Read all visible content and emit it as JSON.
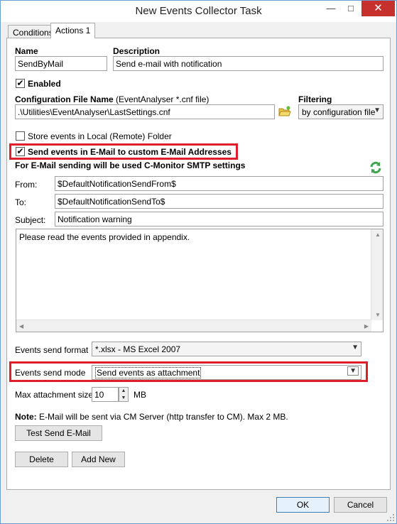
{
  "window": {
    "title": "New Events Collector Task",
    "minimize": "—",
    "maximize": "□",
    "close": "✕"
  },
  "tabs": [
    {
      "label": "Conditions"
    },
    {
      "label": "Actions 1"
    }
  ],
  "form": {
    "name_label": "Name",
    "name_value": "SendByMail",
    "description_label": "Description",
    "description_value": "Send e-mail with notification",
    "enabled_label": "Enabled",
    "config_label_bold": "Configuration File Name",
    "config_label_rest": " (EventAnalyser *.cnf file)",
    "config_value": ".\\Utilities\\EventAnalyser\\LastSettings.cnf",
    "filtering_label": "Filtering",
    "filtering_value": "by configuration file",
    "store_label": "Store events in Local (Remote) Folder",
    "send_email_label": "Send events in E-Mail to custom E-Mail Addresses",
    "smtp_note": "For E-Mail sending will be used C-Monitor SMTP settings",
    "from_label": "From:",
    "from_value": "$DefaultNotificationSendFrom$",
    "to_label": "To:",
    "to_value": "$DefaultNotificationSendTo$",
    "subject_label": "Subject:",
    "subject_value": "Notification warning",
    "body_value": "Please read the events provided in appendix.",
    "format_label": "Events send format",
    "format_value": "*.xlsx - MS Excel 2007",
    "mode_label": "Events send mode",
    "mode_value": "Send events as attachment",
    "max_size_label": "Max attachment size",
    "max_size_value": "10",
    "max_size_unit": "MB",
    "note_bold": "Note:",
    "note_rest": " E-Mail will be sent via CM Server (http transfer to CM). Max 2 MB.",
    "test_button": "Test Send E-Mail",
    "delete_button": "Delete",
    "add_new_button": "Add New"
  },
  "footer": {
    "ok_button": "OK",
    "cancel_button": "Cancel"
  },
  "colors": {
    "highlight_red": "#e01e2b",
    "close_red": "#c7312d"
  }
}
